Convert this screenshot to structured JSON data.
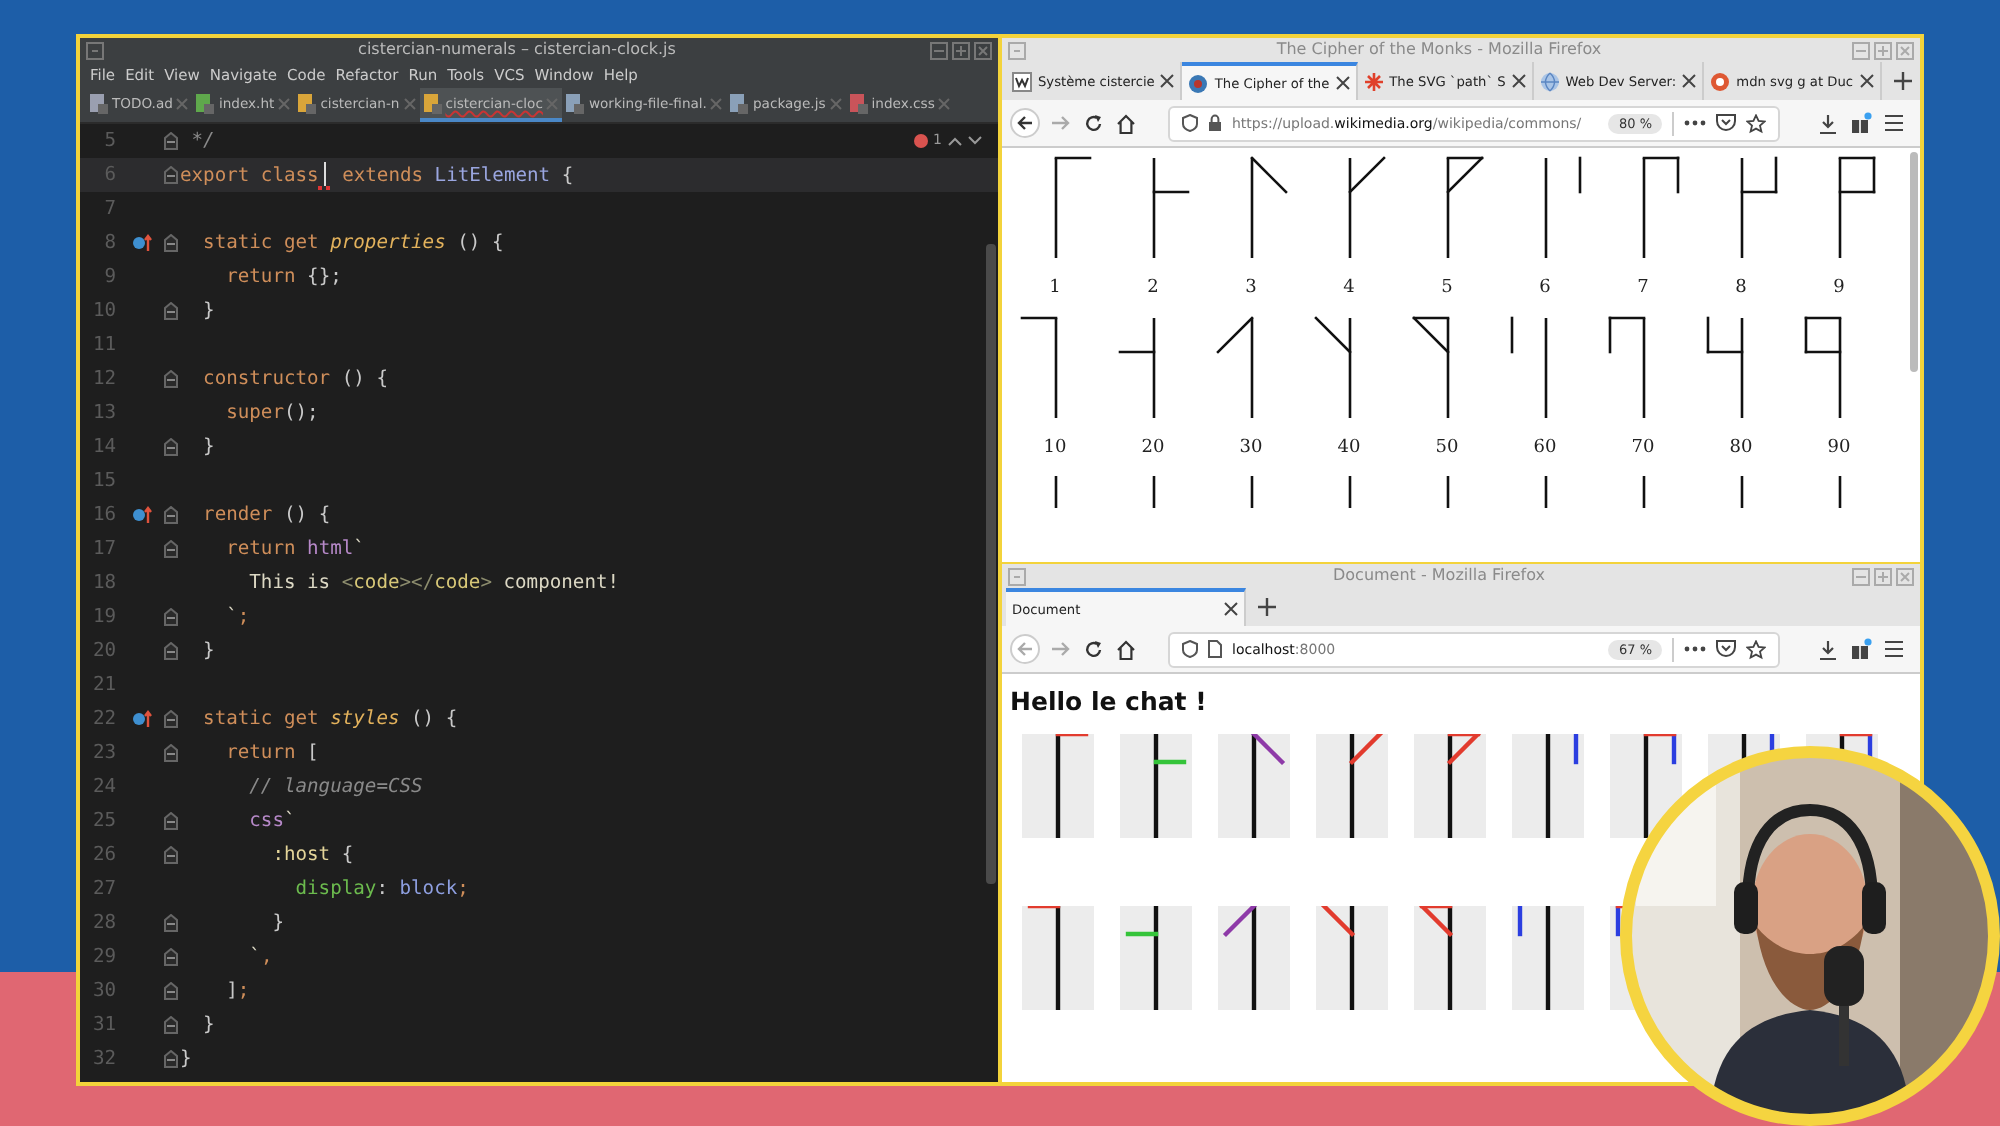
{
  "ide": {
    "title": "cistercian-numerals – cistercian-clock.js",
    "menu": [
      "File",
      "Edit",
      "View",
      "Navigate",
      "Code",
      "Refactor",
      "Run",
      "Tools",
      "VCS",
      "Window",
      "Help"
    ],
    "tabs": [
      {
        "label": "TODO.ad",
        "kind": "text",
        "selected": false
      },
      {
        "label": "index.ht",
        "kind": "html",
        "selected": false
      },
      {
        "label": "cistercian-n",
        "kind": "js",
        "selected": false
      },
      {
        "label": "cistercian-cloc",
        "kind": "js",
        "selected": true
      },
      {
        "label": "working-file-final.",
        "kind": "json",
        "selected": false
      },
      {
        "label": "package.js",
        "kind": "json",
        "selected": false
      },
      {
        "label": "index.css",
        "kind": "css",
        "selected": false
      }
    ],
    "problems": "1",
    "lines": [
      {
        "number": "5",
        "current": false,
        "override": false,
        "fold": true,
        "tokens": [
          {
            "kind": "cm",
            "text": " */"
          }
        ]
      },
      {
        "number": "6",
        "current": true,
        "override": false,
        "fold": true,
        "tokens": [
          {
            "kind": "kw",
            "text": "export class"
          },
          {
            "kind": "kw",
            "text": " extends"
          },
          {
            "kind": "cls",
            "text": " LitElement"
          },
          {
            "kind": "plain",
            "text": " {"
          }
        ]
      },
      {
        "number": "7",
        "current": false,
        "override": false,
        "fold": false
      },
      {
        "number": "8",
        "current": false,
        "override": true,
        "fold": true,
        "tokens": [
          {
            "kind": "kw",
            "text": "  static get"
          },
          {
            "kind": "fni",
            "text": " properties"
          },
          {
            "kind": "plain",
            "text": " () {"
          }
        ]
      },
      {
        "number": "9",
        "current": false,
        "override": false,
        "fold": false,
        "tokens": [
          {
            "kind": "kw",
            "text": "    return"
          },
          {
            "kind": "plain",
            "text": " {};"
          }
        ]
      },
      {
        "number": "10",
        "current": false,
        "override": false,
        "fold": true,
        "tokens": [
          {
            "kind": "plain",
            "text": "  }"
          }
        ]
      },
      {
        "number": "11",
        "current": false,
        "override": false,
        "fold": false
      },
      {
        "number": "12",
        "current": false,
        "override": false,
        "fold": true,
        "tokens": [
          {
            "kind": "kw",
            "text": "  constructor"
          },
          {
            "kind": "plain",
            "text": " () {"
          }
        ]
      },
      {
        "number": "13",
        "current": false,
        "override": false,
        "fold": false,
        "tokens": [
          {
            "kind": "kw",
            "text": "    super"
          },
          {
            "kind": "plain",
            "text": "();"
          }
        ]
      },
      {
        "number": "14",
        "current": false,
        "override": false,
        "fold": true,
        "tokens": [
          {
            "kind": "plain",
            "text": "  }"
          }
        ]
      },
      {
        "number": "15",
        "current": false,
        "override": false,
        "fold": false
      },
      {
        "number": "16",
        "current": false,
        "override": true,
        "fold": true,
        "tokens": [
          {
            "kind": "kw",
            "text": "  render"
          },
          {
            "kind": "plain",
            "text": " () {"
          }
        ]
      },
      {
        "number": "17",
        "current": false,
        "override": false,
        "fold": true,
        "tokens": [
          {
            "kind": "kw",
            "text": "    return"
          },
          {
            "kind": "tag",
            "text": " html"
          },
          {
            "kind": "str",
            "text": "`"
          }
        ]
      },
      {
        "number": "18",
        "current": false,
        "override": false,
        "fold": false,
        "tokens": [
          {
            "kind": "str",
            "text": "      This is"
          },
          {
            "kind": "tagb",
            "text": " <"
          },
          {
            "kind": "tagn",
            "text": "code"
          },
          {
            "kind": "tagb",
            "text": "></"
          },
          {
            "kind": "tagn",
            "text": "code"
          },
          {
            "kind": "tagb",
            "text": ">"
          },
          {
            "kind": "str",
            "text": " component!"
          }
        ]
      },
      {
        "number": "19",
        "current": false,
        "override": false,
        "fold": true,
        "tokens": [
          {
            "kind": "str",
            "text": "    `"
          },
          {
            "kind": "kw",
            "text": ";"
          }
        ]
      },
      {
        "number": "20",
        "current": false,
        "override": false,
        "fold": true,
        "tokens": [
          {
            "kind": "plain",
            "text": "  }"
          }
        ]
      },
      {
        "number": "21",
        "current": false,
        "override": false,
        "fold": false
      },
      {
        "number": "22",
        "current": false,
        "override": true,
        "fold": true,
        "tokens": [
          {
            "kind": "kw",
            "text": "  static get"
          },
          {
            "kind": "fni",
            "text": " styles"
          },
          {
            "kind": "plain",
            "text": " () {"
          }
        ]
      },
      {
        "number": "23",
        "current": false,
        "override": false,
        "fold": true,
        "tokens": [
          {
            "kind": "kw",
            "text": "    return"
          },
          {
            "kind": "plain",
            "text": " ["
          }
        ]
      },
      {
        "number": "24",
        "current": false,
        "override": false,
        "fold": false,
        "tokens": [
          {
            "kind": "cm",
            "text": "      // language=CSS"
          }
        ]
      },
      {
        "number": "25",
        "current": false,
        "override": false,
        "fold": true,
        "tokens": [
          {
            "kind": "tag",
            "text": "      css"
          },
          {
            "kind": "str",
            "text": "`"
          }
        ]
      },
      {
        "number": "26",
        "current": false,
        "override": false,
        "fold": true,
        "tokens": [
          {
            "kind": "sel",
            "text": "        :host"
          },
          {
            "kind": "plain",
            "text": " {"
          }
        ]
      },
      {
        "number": "27",
        "current": false,
        "override": false,
        "fold": false,
        "tokens": [
          {
            "kind": "cssp",
            "text": "          display"
          },
          {
            "kind": "plain",
            "text": ":"
          },
          {
            "kind": "cssv",
            "text": " block"
          },
          {
            "kind": "kw",
            "text": ";"
          }
        ]
      },
      {
        "number": "28",
        "current": false,
        "override": false,
        "fold": true,
        "tokens": [
          {
            "kind": "plain",
            "text": "        }"
          }
        ]
      },
      {
        "number": "29",
        "current": false,
        "override": false,
        "fold": true,
        "tokens": [
          {
            "kind": "str",
            "text": "      `"
          },
          {
            "kind": "kw",
            "text": ","
          }
        ]
      },
      {
        "number": "30",
        "current": false,
        "override": false,
        "fold": true,
        "tokens": [
          {
            "kind": "plain",
            "text": "    ]"
          },
          {
            "kind": "kw",
            "text": ";"
          }
        ]
      },
      {
        "number": "31",
        "current": false,
        "override": false,
        "fold": true,
        "tokens": [
          {
            "kind": "plain",
            "text": "  }"
          }
        ]
      },
      {
        "number": "32",
        "current": false,
        "override": false,
        "fold": true,
        "tokens": [
          {
            "kind": "plain",
            "text": "}"
          }
        ]
      }
    ]
  },
  "browsers": [
    {
      "title": "The Cipher of the Monks - Mozilla Firefox",
      "tabs": [
        {
          "label": "Système cistercie",
          "kind": "wiki",
          "selected": false
        },
        {
          "label": "The Cipher of the",
          "kind": "commons",
          "selected": true
        },
        {
          "label": "The SVG `path` S",
          "kind": "star",
          "selected": false
        },
        {
          "label": "Web Dev Server: ",
          "kind": "globe",
          "selected": false
        },
        {
          "label": "mdn svg g at Duc",
          "kind": "duck",
          "selected": false
        }
      ],
      "url": "https://upload.**wikimedia.org**/wikipedia/commons/",
      "secure": true,
      "zoom": "80 %",
      "content": {
        "kind": "numerals",
        "rows": [
          [
            "1",
            "2",
            "3",
            "4",
            "5",
            "6",
            "7",
            "8",
            "9"
          ],
          [
            "10",
            "20",
            "30",
            "40",
            "50",
            "60",
            "70",
            "80",
            "90"
          ]
        ]
      }
    },
    {
      "title": "Document - Mozilla Firefox",
      "tabs": [
        {
          "label": "Document",
          "kind": "none",
          "selected": true
        }
      ],
      "url": "**localhost**:8000",
      "secure": false,
      "zoom": "67 %",
      "content": {
        "kind": "page",
        "heading": "Hello le chat !"
      }
    }
  ]
}
